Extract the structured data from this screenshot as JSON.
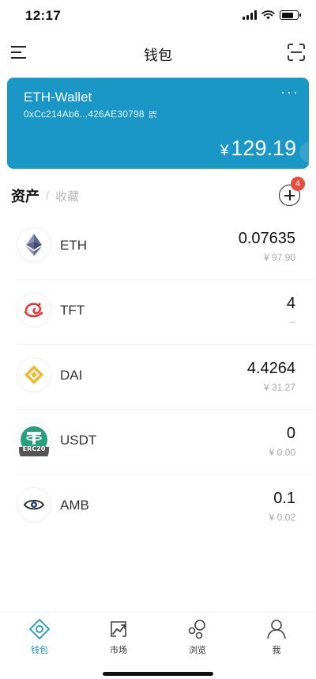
{
  "status_bar": {
    "time": "12:17"
  },
  "nav": {
    "title": "钱包"
  },
  "wallet": {
    "name": "ETH-Wallet",
    "address": "0xCc214Ab6...426AE30798",
    "currency_symbol": "¥",
    "balance": "129.19",
    "more_label": "···",
    "card_color": "#1a97c7"
  },
  "assets": {
    "tab_assets": "资产",
    "tab_separator": "/",
    "tab_collect": "收藏",
    "badge_count": "4"
  },
  "tokens": [
    {
      "icon": "eth-logo-icon",
      "name": "ETH",
      "amount": "0.07635",
      "value": "¥ 97.90"
    },
    {
      "icon": "tft-logo-icon",
      "name": "TFT",
      "amount": "4",
      "value": "~"
    },
    {
      "icon": "dai-logo-icon",
      "name": "DAI",
      "amount": "4.4264",
      "value": "¥ 31.27"
    },
    {
      "icon": "usdt-logo-icon",
      "name": "USDT",
      "amount": "0",
      "value": "¥ 0.00"
    },
    {
      "icon": "amb-logo-icon",
      "name": "AMB",
      "amount": "0.1",
      "value": "¥ 0.02"
    }
  ],
  "tab_bar": {
    "items": [
      {
        "label": "钱包",
        "icon": "wallet-icon",
        "active": true
      },
      {
        "label": "市场",
        "icon": "market-icon",
        "active": false
      },
      {
        "label": "浏览",
        "icon": "browse-icon",
        "active": false
      },
      {
        "label": "我",
        "icon": "profile-icon",
        "active": false
      }
    ],
    "active_color": "#1a97c7"
  }
}
